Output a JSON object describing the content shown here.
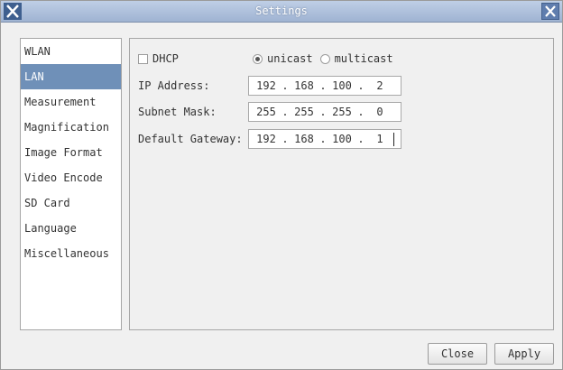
{
  "window": {
    "title": "Settings"
  },
  "icons": {
    "app": "app-x-icon",
    "close": "close-x-icon"
  },
  "colors": {
    "accent": "#6f90b8",
    "titlebar": "#aebfdb"
  },
  "sidebar": {
    "items": [
      {
        "label": "WLAN",
        "active": false
      },
      {
        "label": "LAN",
        "active": true
      },
      {
        "label": "Measurement",
        "active": false
      },
      {
        "label": "Magnification",
        "active": false
      },
      {
        "label": "Image Format",
        "active": false
      },
      {
        "label": "Video Encode",
        "active": false
      },
      {
        "label": "SD Card",
        "active": false
      },
      {
        "label": "Language",
        "active": false
      },
      {
        "label": "Miscellaneous",
        "active": false
      }
    ]
  },
  "lan": {
    "dhcp_label": "DHCP",
    "dhcp_checked": false,
    "unicast_label": "unicast",
    "multicast_label": "multicast",
    "cast_selected": "unicast",
    "ip_label": "IP Address:",
    "ip": [
      "192",
      "168",
      "100",
      "2"
    ],
    "subnet_label": "Subnet Mask:",
    "subnet": [
      "255",
      "255",
      "255",
      "0"
    ],
    "gateway_label": "Default Gateway:",
    "gateway": [
      "192",
      "168",
      "100",
      "1"
    ],
    "separator": "."
  },
  "buttons": {
    "close": "Close",
    "apply": "Apply"
  }
}
